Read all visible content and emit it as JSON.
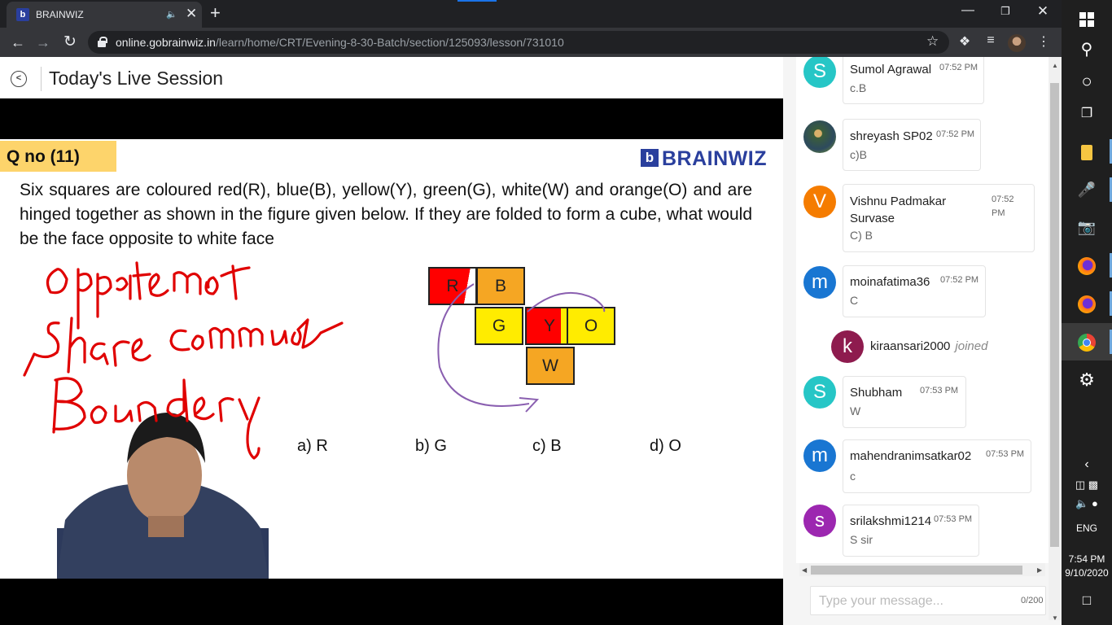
{
  "browser": {
    "tab_title": "BRAINWIZ",
    "favicon_letter": "b",
    "audio_icon": "speaker-icon",
    "new_tab": "+",
    "url_host": "online.gobrainwiz.in",
    "url_path": "/learn/home/CRT/Evening-8-30-Batch/section/125093/lesson/731010"
  },
  "header": {
    "title": "Today's Live Session"
  },
  "slide": {
    "qno": "Q no (11)",
    "logo": "BRAINWIZ",
    "logo_mark": "b",
    "question": "Six squares are coloured red(R), blue(B), yellow(Y), green(G), white(W) and orange(O) and are hinged together as shown in the figure given below. If they are folded to form a cube, what would be the face opposite to white face",
    "cells": [
      "R",
      "B",
      "G",
      "Y",
      "O",
      "W"
    ],
    "options": [
      "a) R",
      "b) G",
      "c) B",
      "d) O"
    ],
    "handwriting": [
      "opposite not",
      "share common",
      "Boundry"
    ],
    "colors": {
      "red": "#ff0000",
      "orange": "#f5a623",
      "yellow": "#ffec00",
      "ink": "#e00000",
      "arrow": "#8a5fb0"
    }
  },
  "chat": {
    "messages": [
      {
        "initial": "S",
        "name": "Sumol Agrawal",
        "time": "07:52 PM",
        "text": "c.B",
        "color": "#26c6c6"
      },
      {
        "initial": "",
        "name": "shreyash SP02",
        "time": "07:52 PM",
        "text": "c)B",
        "color": "#3b5e3a"
      },
      {
        "initial": "V",
        "name": "Vishnu Padmakar Survase",
        "time": "07:52 PM",
        "text": "C) B",
        "color": "#f57c00"
      },
      {
        "initial": "m",
        "name": "moinafatima36",
        "time": "07:52 PM",
        "text": "C",
        "color": "#1976d2"
      },
      {
        "initial": "S",
        "name": "Shubham",
        "time": "07:53 PM",
        "text": "W",
        "color": "#26c6c6"
      },
      {
        "initial": "m",
        "name": "mahendranimsatkar02",
        "time": "07:53 PM",
        "text": "c",
        "color": "#1976d2"
      },
      {
        "initial": "s",
        "name": "srilakshmi1214",
        "time": "07:53 PM",
        "text": "S sir",
        "color": "#9c27b0"
      }
    ],
    "join_event": {
      "initial": "k",
      "name": "kiraansari2000",
      "suffix": "joined",
      "color": "#8e1b4e"
    },
    "input_placeholder": "Type your message...",
    "char_count": "0/200"
  },
  "taskbar": {
    "language": "ENG",
    "time": "7:54 PM",
    "date": "9/10/2020"
  }
}
